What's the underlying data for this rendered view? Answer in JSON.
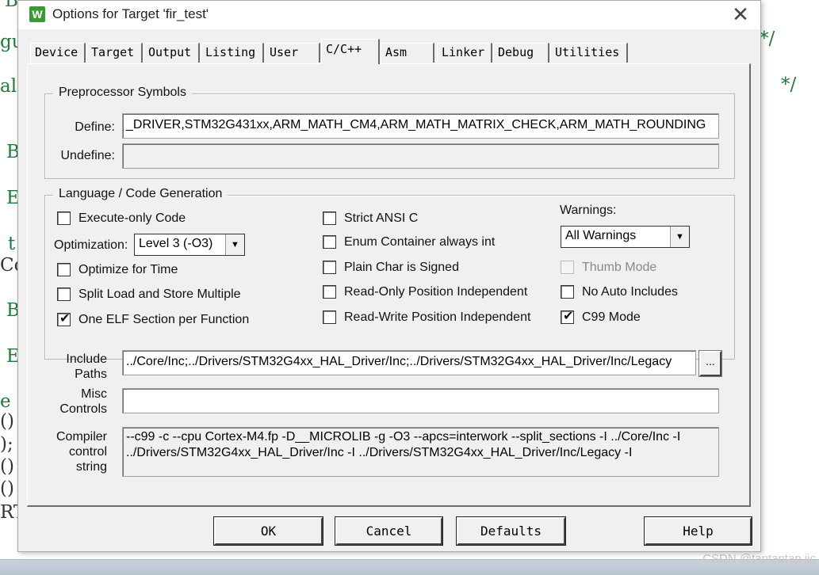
{
  "background": {
    "fragments": [
      {
        "text": "B",
        "cls": ""
      },
      {
        "text": "gu",
        "cls": ""
      },
      {
        "text": "al",
        "cls": ""
      },
      {
        "text": "B",
        "cls": ""
      },
      {
        "text": "E",
        "cls": ""
      },
      {
        "text": "t",
        "cls": ""
      },
      {
        "text": "Co",
        "cls": "dark"
      },
      {
        "text": "B",
        "cls": ""
      },
      {
        "text": "E",
        "cls": ""
      },
      {
        "text": "e",
        "cls": ""
      },
      {
        "text": "()",
        "cls": "dark"
      },
      {
        "text": ");",
        "cls": "dark"
      },
      {
        "text": "()",
        "cls": "dark"
      },
      {
        "text": "()",
        "cls": "dark"
      },
      {
        "text": "RT",
        "cls": "dark"
      },
      {
        "text": "*/",
        "cls": ""
      },
      {
        "text": "*/",
        "cls": ""
      }
    ],
    "watermark": "CSDN @taptaptap.jic"
  },
  "dialog": {
    "title": "Options for Target 'fir_test'",
    "icon_glyph": "W",
    "close_glyph": "✕"
  },
  "tabs": [
    "Device",
    "Target",
    "Output",
    "Listing",
    "User",
    "C/C++",
    "Asm",
    "Linker",
    "Debug",
    "Utilities"
  ],
  "active_tab": "C/C++",
  "preprocessor": {
    "title": "Preprocessor Symbols",
    "define_label": "Define:",
    "define_value": "_DRIVER,STM32G431xx,ARM_MATH_CM4,ARM_MATH_MATRIX_CHECK,ARM_MATH_ROUNDING",
    "undefine_label": "Undefine:",
    "undefine_value": ""
  },
  "language": {
    "title": "Language / Code Generation",
    "execute_only": {
      "label": "Execute-only Code",
      "checked": false
    },
    "optimization_label": "Optimization:",
    "optimization_value": "Level 3 (-O3)",
    "optimize_time": {
      "label": "Optimize for Time",
      "checked": false
    },
    "split_load": {
      "label": "Split Load and Store Multiple",
      "checked": false
    },
    "one_elf": {
      "label": "One ELF Section per Function",
      "checked": true
    },
    "strict_ansi": {
      "label": "Strict ANSI C",
      "checked": false
    },
    "enum_container": {
      "label": "Enum Container always int",
      "checked": false
    },
    "plain_char": {
      "label": "Plain Char is Signed",
      "checked": false
    },
    "ro_pi": {
      "label": "Read-Only Position Independent",
      "checked": false
    },
    "rw_pi": {
      "label": "Read-Write Position Independent",
      "checked": false
    },
    "warnings_label": "Warnings:",
    "warnings_value": "All Warnings",
    "thumb_mode": {
      "label": "Thumb Mode",
      "checked": false,
      "disabled": true
    },
    "no_auto_includes": {
      "label": "No Auto Includes",
      "checked": false
    },
    "c99_mode": {
      "label": "C99 Mode",
      "checked": true
    }
  },
  "include_paths": {
    "label_line1": "Include",
    "label_line2": "Paths",
    "value": "../Core/Inc;../Drivers/STM32G4xx_HAL_Driver/Inc;../Drivers/STM32G4xx_HAL_Driver/Inc/Legacy",
    "browse_label": "..."
  },
  "misc_controls": {
    "label_line1": "Misc",
    "label_line2": "Controls",
    "value": ""
  },
  "compiler_string": {
    "label_line1": "Compiler",
    "label_line2": "control",
    "label_line3": "string",
    "value": "--c99 -c --cpu Cortex-M4.fp -D__MICROLIB -g -O3 --apcs=interwork --split_sections -I ../Core/Inc -I ../Drivers/STM32G4xx_HAL_Driver/Inc -I ../Drivers/STM32G4xx_HAL_Driver/Inc/Legacy -I"
  },
  "buttons": {
    "ok": "OK",
    "cancel": "Cancel",
    "defaults": "Defaults",
    "help": "Help"
  },
  "check_glyph": "✔"
}
